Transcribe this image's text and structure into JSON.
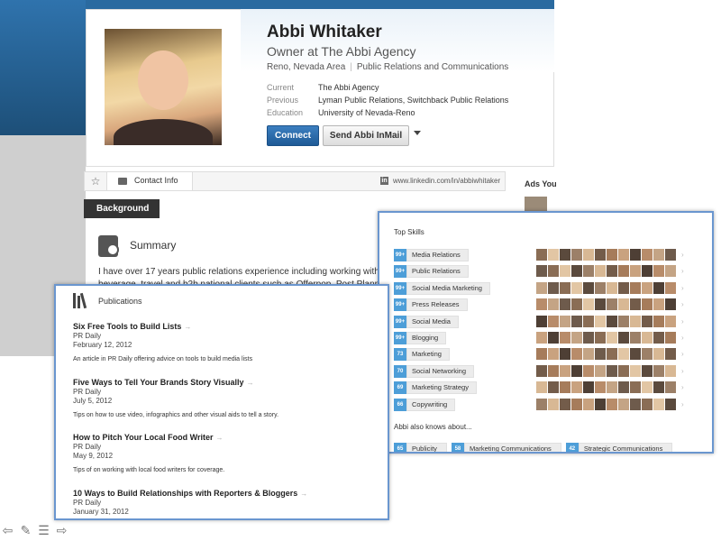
{
  "profile": {
    "name": "Abbi Whitaker",
    "headline": "Owner at The Abbi Agency",
    "location": "Reno, Nevada Area",
    "industry": "Public Relations and Communications",
    "facts": [
      {
        "label": "Current",
        "value": "The Abbi Agency"
      },
      {
        "label": "Previous",
        "value": "Lyman Public Relations, Switchback Public Relations"
      },
      {
        "label": "Education",
        "value": "University of Nevada-Reno"
      }
    ],
    "connect_label": "Connect",
    "inmail_label": "Send Abbi InMail"
  },
  "contact": {
    "label": "Contact Info",
    "url": "www.linkedin.com/in/abbiwhitaker"
  },
  "ads_label": "Ads You",
  "background_tab": "Background",
  "summary": {
    "title": "Summary",
    "text_line1": "I have over 17 years public relations experience including working with fran",
    "text_line2": "beverage, travel and b2b national clients such as Offerpop, Post Planner, L"
  },
  "publications": {
    "title": "Publications",
    "items": [
      {
        "title": "Six Free Tools to Build Lists",
        "publisher": "PR Daily",
        "date": "February 12, 2012",
        "desc": "An article in PR Daily offering advice on tools to build media lists"
      },
      {
        "title": "Five Ways to Tell Your Brands Story Visually",
        "publisher": "PR Daily",
        "date": "July 5, 2012",
        "desc": "Tips on how to use video, infographics and other visual aids to tell a story."
      },
      {
        "title": "How to Pitch Your Local Food Writer",
        "publisher": "PR Daily",
        "date": "May 9, 2012",
        "desc": "Tips of on working with local food writers for coverage."
      },
      {
        "title": "10 Ways to Build Relationships with Reporters & Bloggers",
        "publisher": "PR Daily",
        "date": "January 31, 2012",
        "desc": ""
      }
    ]
  },
  "skills": {
    "title": "Top Skills",
    "items": [
      {
        "count": "99+",
        "name": "Media Relations"
      },
      {
        "count": "99+",
        "name": "Public Relations"
      },
      {
        "count": "99+",
        "name": "Social Media Marketing"
      },
      {
        "count": "99+",
        "name": "Press Releases"
      },
      {
        "count": "99+",
        "name": "Social Media"
      },
      {
        "count": "99+",
        "name": "Blogging"
      },
      {
        "count": "73",
        "name": "Marketing"
      },
      {
        "count": "70",
        "name": "Social Networking"
      },
      {
        "count": "69",
        "name": "Marketing Strategy"
      },
      {
        "count": "66",
        "name": "Copywriting"
      }
    ],
    "also_knows_title": "Abbi also knows about...",
    "also_knows": [
      {
        "count": "65",
        "name": "Publicity"
      },
      {
        "count": "58",
        "name": "Marketing Communications"
      },
      {
        "count": "42",
        "name": "Strategic Communications"
      }
    ]
  },
  "colors": {
    "accent": "#4d9ed8",
    "connect": "#2a6aa7",
    "callout_border": "#6a96cf"
  },
  "icons": [
    "star-icon",
    "contact-card-icon",
    "linkedin-icon",
    "summary-icon",
    "publications-icon",
    "back-arrow-icon",
    "pencil-icon",
    "list-icon",
    "forward-arrow-icon"
  ]
}
